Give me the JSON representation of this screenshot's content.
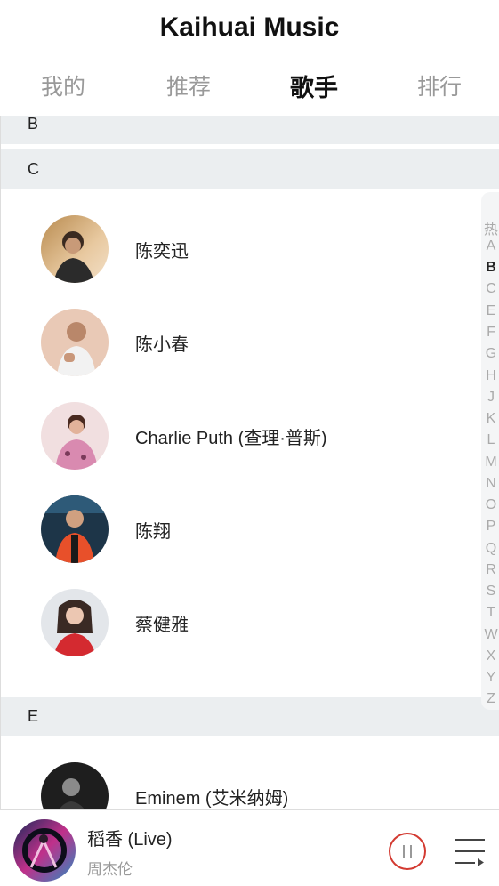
{
  "app": {
    "title": "Kaihuai Music"
  },
  "tabs": [
    {
      "label": "我的",
      "active": false
    },
    {
      "label": "推荐",
      "active": false
    },
    {
      "label": "歌手",
      "active": true
    },
    {
      "label": "排行",
      "active": false
    }
  ],
  "sections": [
    {
      "letter": "B"
    },
    {
      "letter": "C",
      "artists": [
        {
          "name": "陈奕迅"
        },
        {
          "name": "陈小春"
        },
        {
          "name": "Charlie Puth (查理·普斯)"
        },
        {
          "name": "陈翔"
        },
        {
          "name": "蔡健雅"
        }
      ]
    },
    {
      "letter": "E",
      "artists": [
        {
          "name": "Eminem (艾米纳姆)"
        }
      ]
    }
  ],
  "alpha_index": {
    "letters": [
      "热",
      "A",
      "B",
      "C",
      "E",
      "F",
      "G",
      "H",
      "J",
      "K",
      "L",
      "M",
      "N",
      "O",
      "P",
      "Q",
      "R",
      "S",
      "T",
      "W",
      "X",
      "Y",
      "Z"
    ],
    "active": "B"
  },
  "player": {
    "title": "稻香 (Live)",
    "artist": "周杰伦",
    "state": "playing"
  },
  "colors": {
    "accent": "#d33a31",
    "section_bg": "#ebeef0"
  }
}
